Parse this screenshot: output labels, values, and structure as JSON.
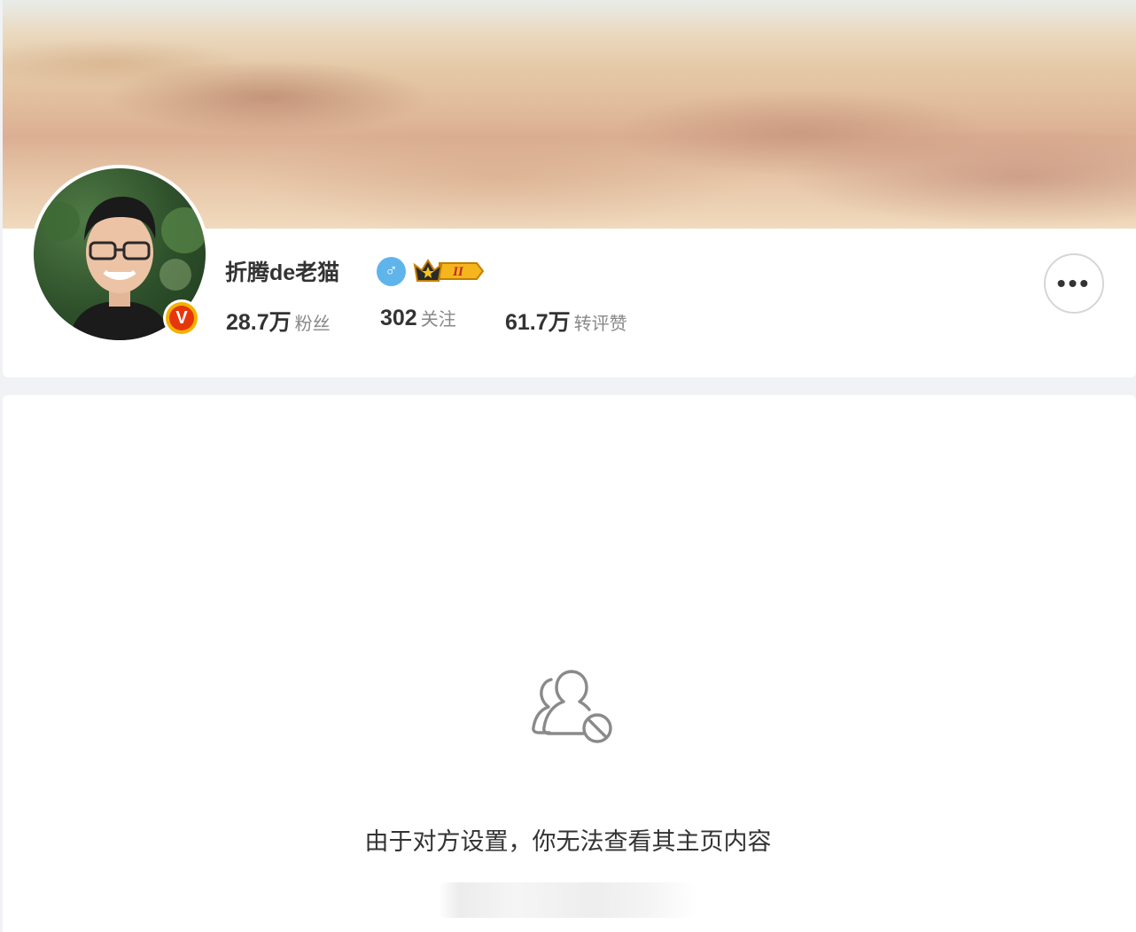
{
  "profile": {
    "name": "折腾de老猫",
    "gender_icon": "male-icon",
    "gender_symbol": "♂",
    "verified_symbol": "V",
    "vip_label": "II",
    "stats": [
      {
        "value": "28.7万",
        "label": "粉丝"
      },
      {
        "value": "302",
        "label": "关注"
      },
      {
        "value": "61.7万",
        "label": "转评赞"
      }
    ],
    "more_symbol": "•••"
  },
  "content": {
    "blocked_message": "由于对方设置，你无法查看其主页内容",
    "icon": "user-blocked-icon"
  },
  "colors": {
    "page_bg": "#f1f2f5",
    "verified_orange": "#e8360c",
    "verified_gold": "#f2b200",
    "gender_blue": "#60b4ec",
    "text_dark": "#333333",
    "text_gray": "#888888"
  }
}
